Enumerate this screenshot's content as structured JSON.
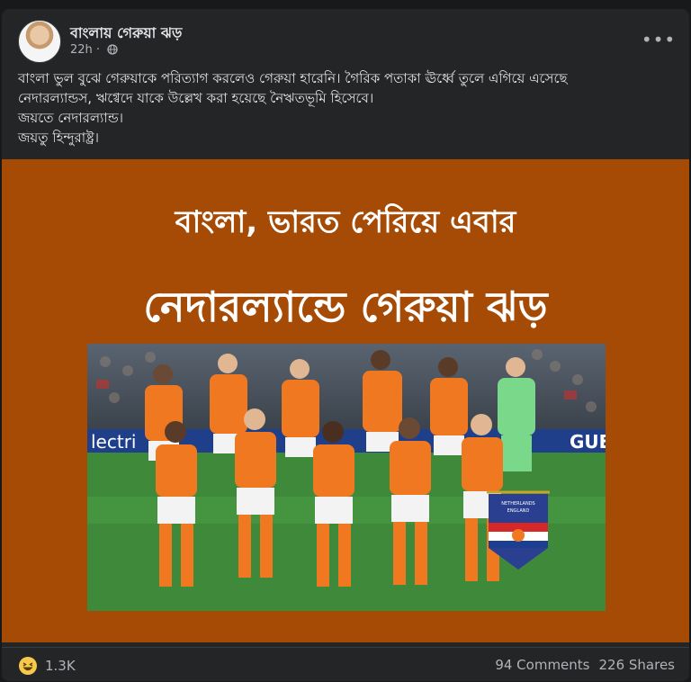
{
  "post": {
    "author": "বাংলায় গেরুয়া ঝড়",
    "time": "22h",
    "privacy_icon": "globe-icon",
    "more_icon": "more-options-icon",
    "text_lines": [
      "বাংলা ভুল বুঝে গেরুয়াকে পরিত্যাগ করলেও গেরুয়া হারেনি। গৈরিক পতাকা ঊর্ধ্বে তুলে এগিয়ে এসেছে",
      "নেদারল্যান্ডস, ঋগ্বেদে যাকে উল্লেখ করা হয়েছে নৈঋতভূমি হিসেবে।",
      "জয়তে নেদারল্যান্ড।",
      "জয়তু হিন্দুরাষ্ট্র।"
    ]
  },
  "media": {
    "headline_top": "বাংলা, ভারত পেরিয়ে এবার",
    "headline_bottom": "নেদারল্যান্ডে গেরুয়া ঝড়",
    "background_color": "#a64b06",
    "photo": {
      "ad_board_left": "lectri",
      "ad_board_right": "GUE",
      "pennant_line1": "NETHERLANDS",
      "pennant_line2": "ENGLAND"
    }
  },
  "footer": {
    "reaction_icon": "haha-reaction-icon",
    "reaction_count": "1.3K",
    "comments": "94 Comments",
    "shares": "226 Shares"
  }
}
